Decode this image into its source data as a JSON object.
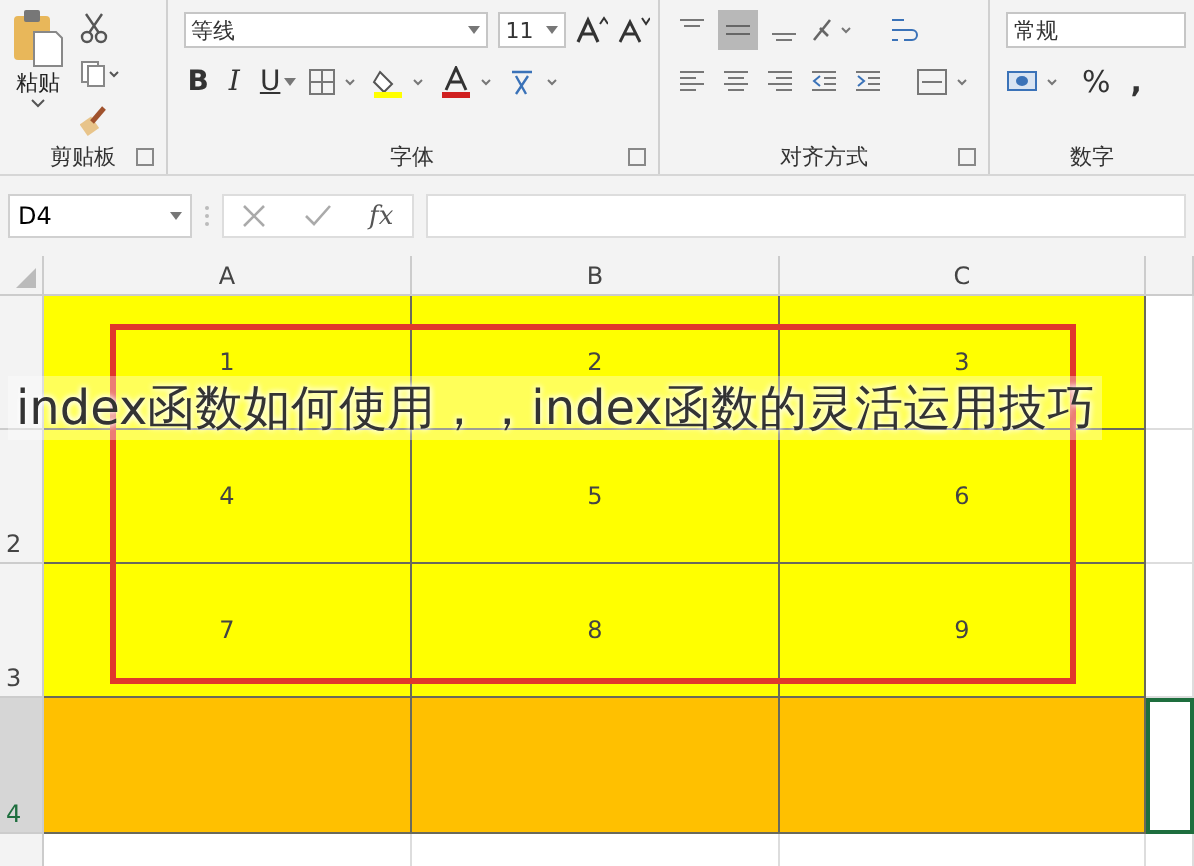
{
  "ribbon": {
    "clipboard": {
      "paste_label": "粘贴",
      "label": "剪贴板"
    },
    "font": {
      "font_name": "等线",
      "font_size": "11",
      "bold": "B",
      "italic": "I",
      "underline": "U",
      "label": "字体"
    },
    "alignment": {
      "label": "对齐方式"
    },
    "number": {
      "format": "常规",
      "percent": "%",
      "comma": ",",
      "label": "数字"
    }
  },
  "formula_bar": {
    "name_box": "D4",
    "fx": "fx"
  },
  "sheet": {
    "columns": [
      "A",
      "B",
      "C"
    ],
    "rows": [
      {
        "selected": false,
        "color": "#ffff00",
        "cells": [
          "1",
          "2",
          "3"
        ]
      },
      {
        "header": "2",
        "selected": false,
        "color": "#ffff00",
        "cells": [
          "4",
          "5",
          "6"
        ]
      },
      {
        "header": "3",
        "selected": false,
        "color": "#ffff00",
        "cells": [
          "7",
          "8",
          "9"
        ]
      },
      {
        "header": "4",
        "selected": true,
        "color": "#ffc000",
        "cells": []
      }
    ]
  },
  "overlay_caption": "index函数如何使用，，index函数的灵活运用技巧"
}
